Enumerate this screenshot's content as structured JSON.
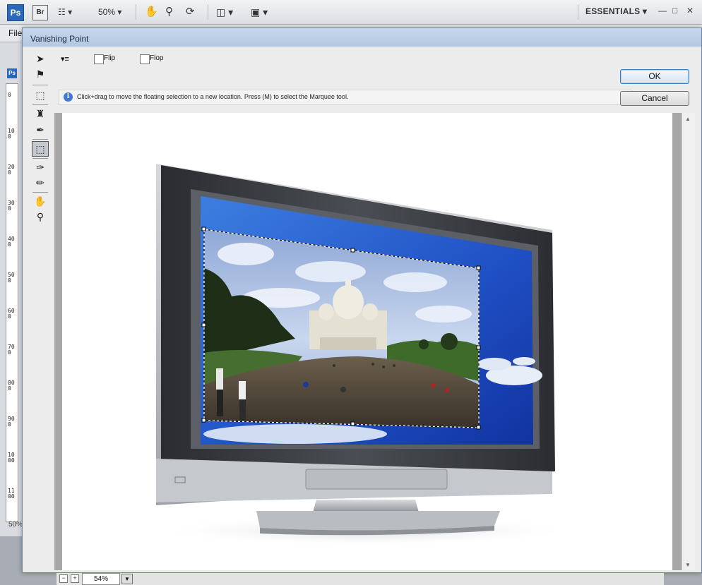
{
  "app": {
    "ps_logo": "Ps",
    "br_logo": "Br",
    "zoom": "50%",
    "workspace": "ESSENTIALS",
    "menu_file": "File",
    "bg_ps": "Ps",
    "bottom_pct": "50%",
    "ruler": [
      "0",
      "100",
      "200",
      "300",
      "400",
      "500",
      "600",
      "700",
      "800",
      "900",
      "1000",
      "1100"
    ]
  },
  "dialog": {
    "title": "Vanishing Point",
    "options": {
      "menu_glyph": "▾≡",
      "flip_label": "Flip",
      "flop_label": "Flop"
    },
    "info_text": "Click+drag to move the floating selection to a new location. Press (M) to select the Marquee tool.",
    "ok_label": "OK",
    "cancel_label": "Cancel",
    "zoom_value": "54%",
    "zoom_minus": "−",
    "zoom_plus": "+"
  },
  "colors": {
    "dialog_title": "#b4c8e2",
    "accent": "#3a7fc3",
    "sky": "#2a63d8"
  }
}
